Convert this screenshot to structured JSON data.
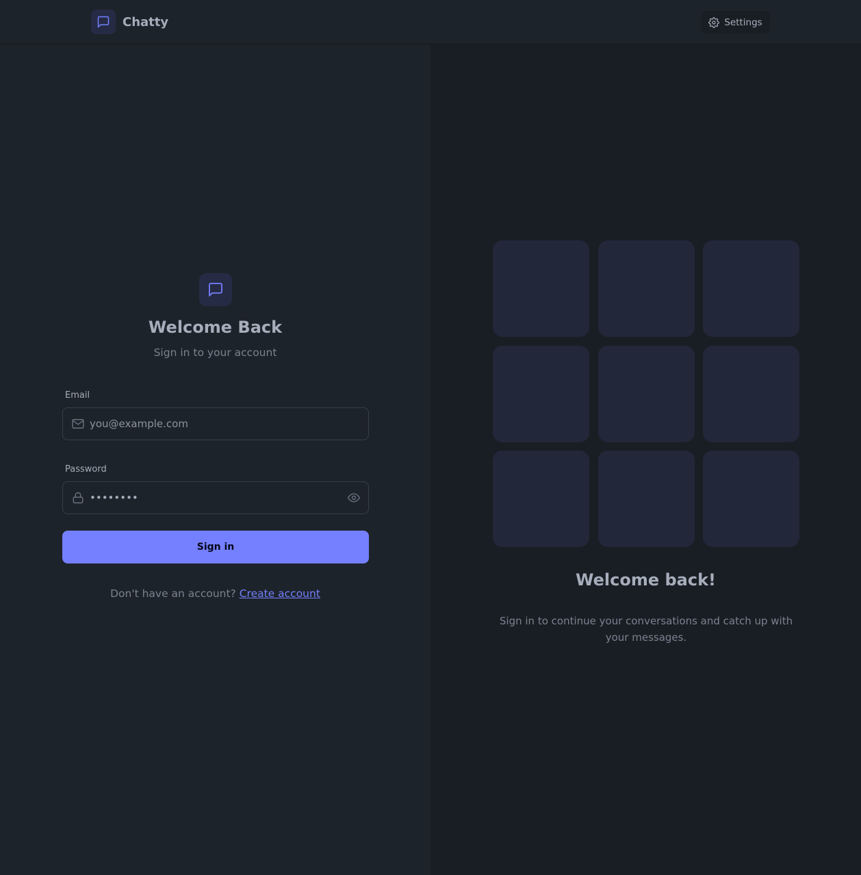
{
  "navbar": {
    "brand_name": "Chatty",
    "brand_icon": "message-square-icon",
    "settings_label": "Settings",
    "settings_icon": "gear-icon"
  },
  "login_form": {
    "logo_icon": "message-square-icon",
    "title": "Welcome Back",
    "subtitle": "Sign in to your account",
    "email": {
      "label": "Email",
      "placeholder": "you@example.com",
      "value": "",
      "icon": "mail-icon"
    },
    "password": {
      "label": "Password",
      "value": "••••••••",
      "icon": "lock-icon",
      "toggle_icon": "eye-icon"
    },
    "submit_label": "Sign in",
    "signup_prompt": "Don't have an account?",
    "signup_link": "Create account"
  },
  "promo": {
    "tile_count": 9,
    "title": "Welcome back!",
    "text": "Sign in to continue your conversations and catch up with your messages."
  },
  "colors": {
    "background": "#1d232a",
    "panel_alt": "#191e24",
    "primary": "#7480ff",
    "tile": "#22273a",
    "text": "#a6adbb",
    "muted_text": "#7b8290"
  }
}
